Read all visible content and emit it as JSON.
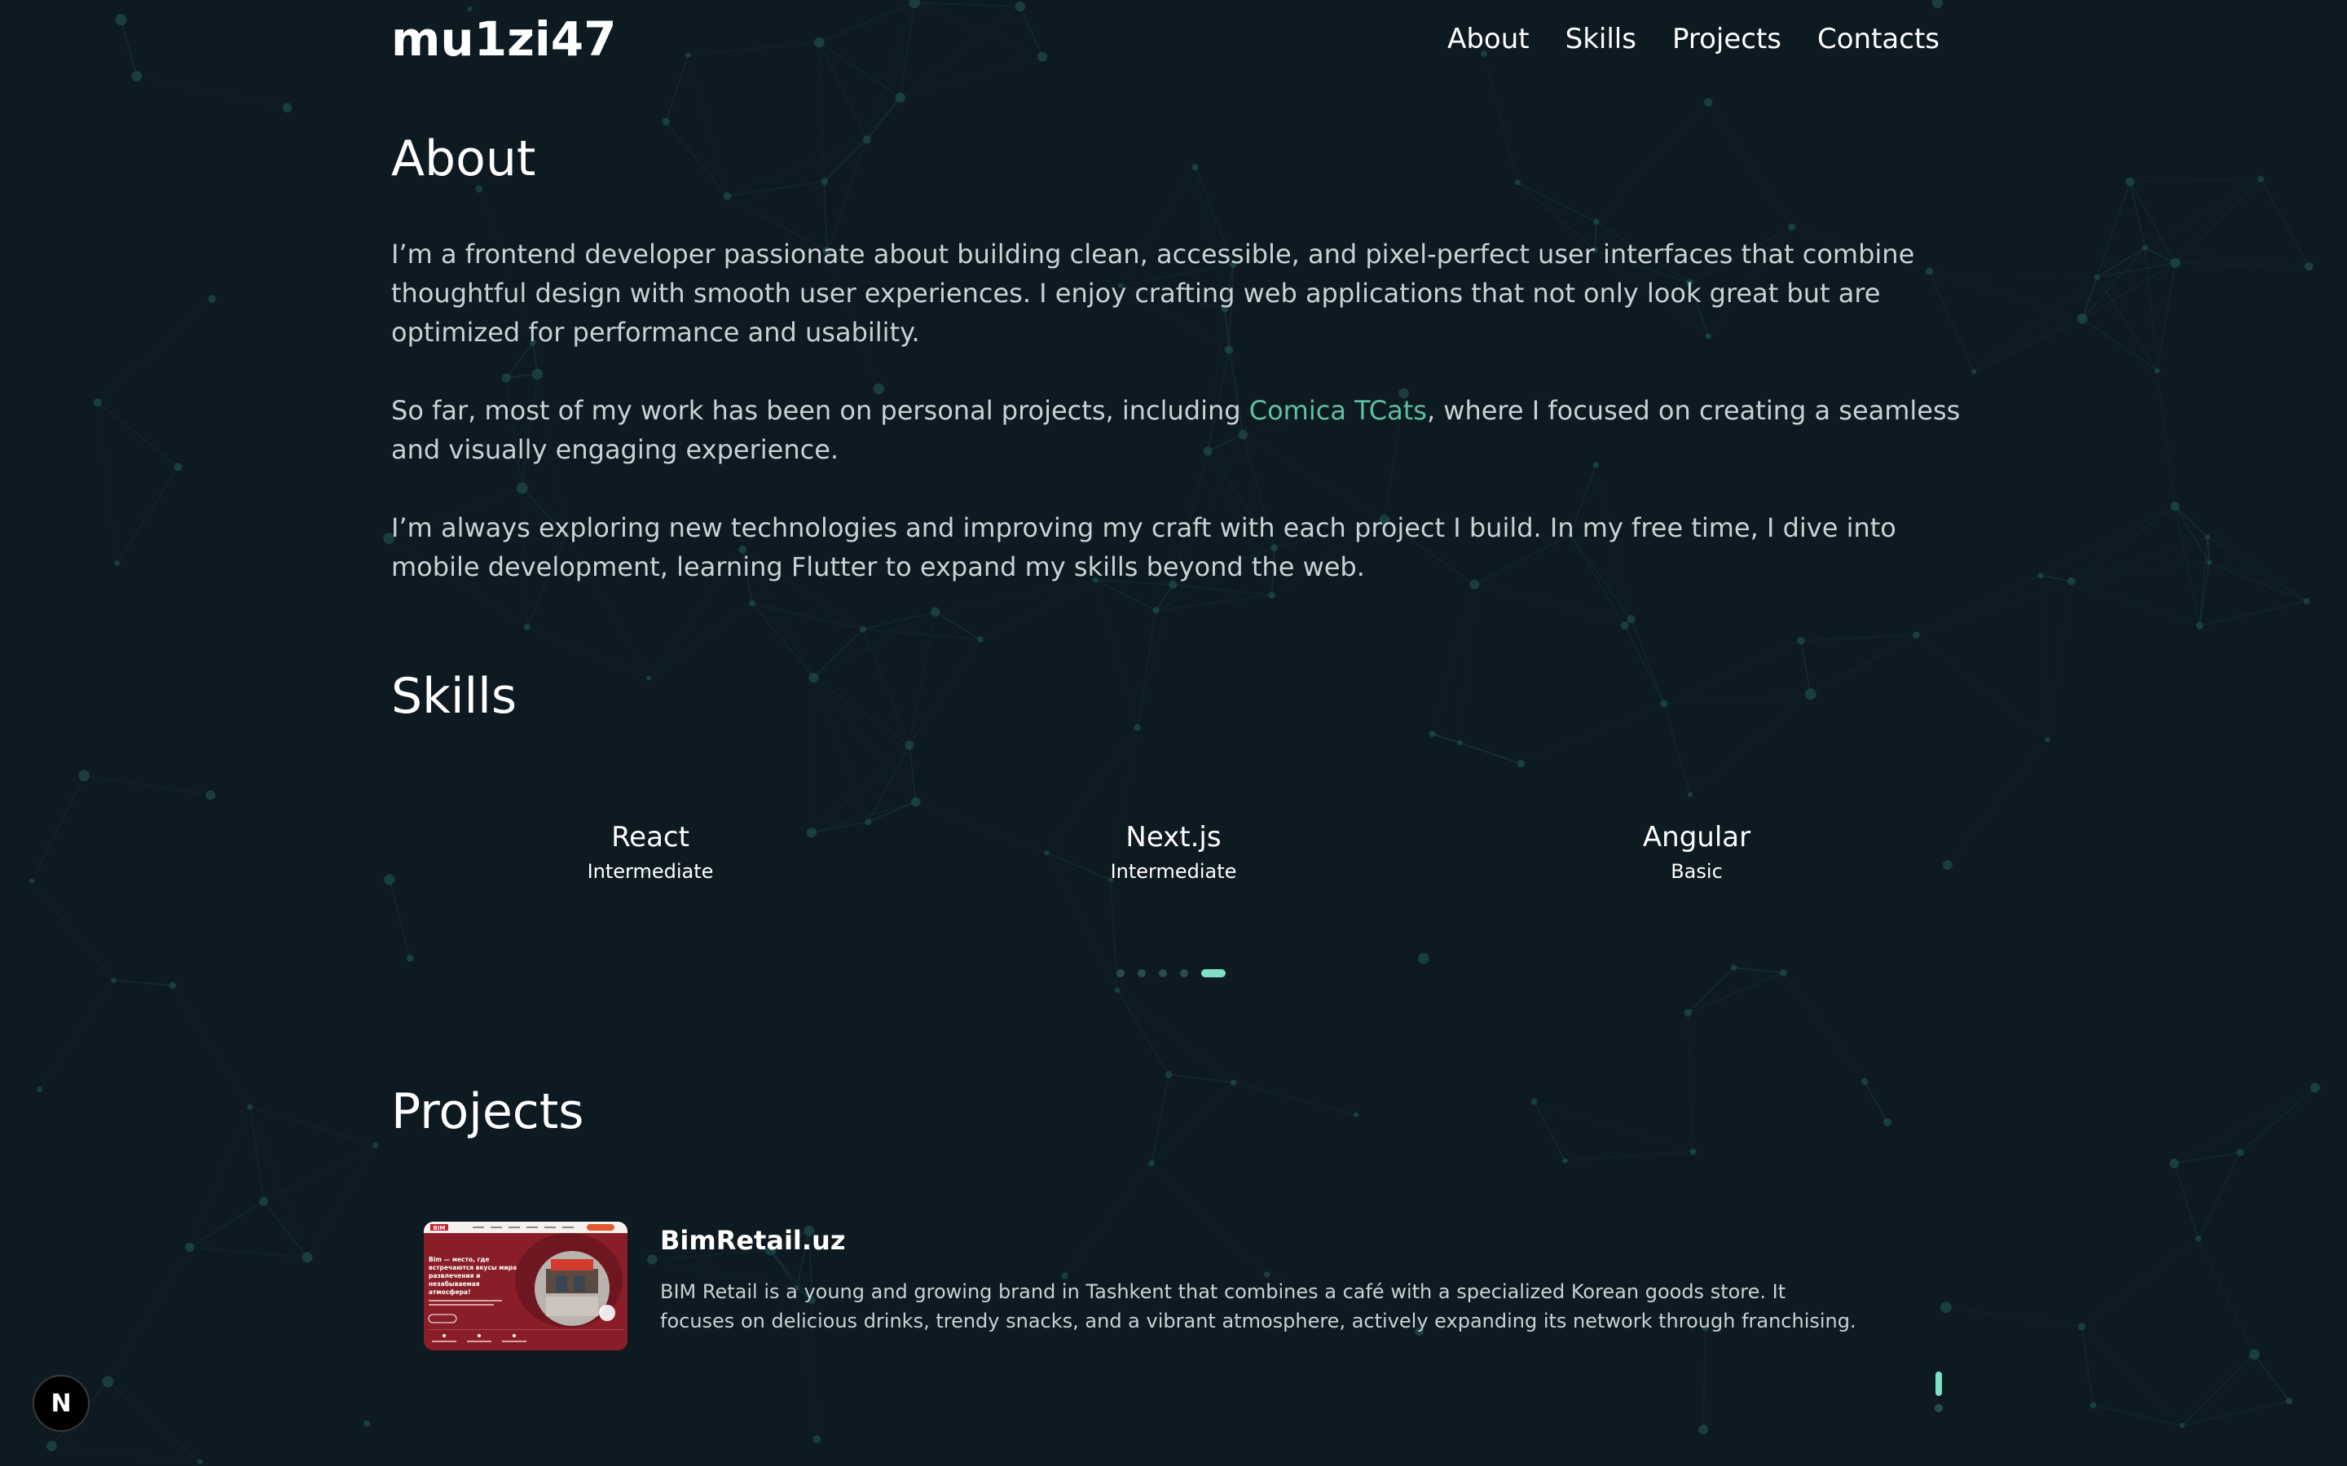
{
  "header": {
    "logo": "mu1zi47",
    "nav": [
      {
        "label": "About"
      },
      {
        "label": "Skills"
      },
      {
        "label": "Projects"
      },
      {
        "label": "Contacts"
      }
    ]
  },
  "about": {
    "title": "About",
    "p1": "I’m a frontend developer passionate about building clean, accessible, and pixel-perfect user interfaces that combine thoughtful design with smooth user experiences. I enjoy crafting web applications that not only look great but are optimized for performance and usability.",
    "p2_before": "So far, most of my work has been on personal projects, including ",
    "p2_link": "Comica TCats",
    "p2_after": ", where I focused on creating a seamless and visually engaging experience.",
    "p3": "I’m always exploring new technologies and improving my craft with each project I build. In my free time, I dive into mobile development, learning Flutter to expand my skills beyond the web."
  },
  "skills": {
    "title": "Skills",
    "items": [
      {
        "name": "React",
        "level": "Intermediate"
      },
      {
        "name": "Next.js",
        "level": "Intermediate"
      },
      {
        "name": "Angular",
        "level": "Basic"
      }
    ],
    "pagination": {
      "total": 5,
      "active": 5
    }
  },
  "projects": {
    "title": "Projects",
    "items": [
      {
        "title": "BimRetail.uz",
        "description": "BIM Retail is a young and growing brand in Tashkent that combines a café with a specialized Korean goods store. It focuses on delicious drinks, trendy snacks, and a vibrant atmosphere, actively expanding its network through franchising.",
        "thumb_brand": "BIM",
        "thumb_headline": "Bim — место, где встречаются вкусы мира, развлечения и незабываемая атмосфера!"
      }
    ]
  },
  "colors": {
    "background": "#0d1a21",
    "accent": "#7ee0c6",
    "link": "#5fbfa3",
    "network": "#1f4a4a"
  },
  "badge": {
    "label": "N"
  }
}
